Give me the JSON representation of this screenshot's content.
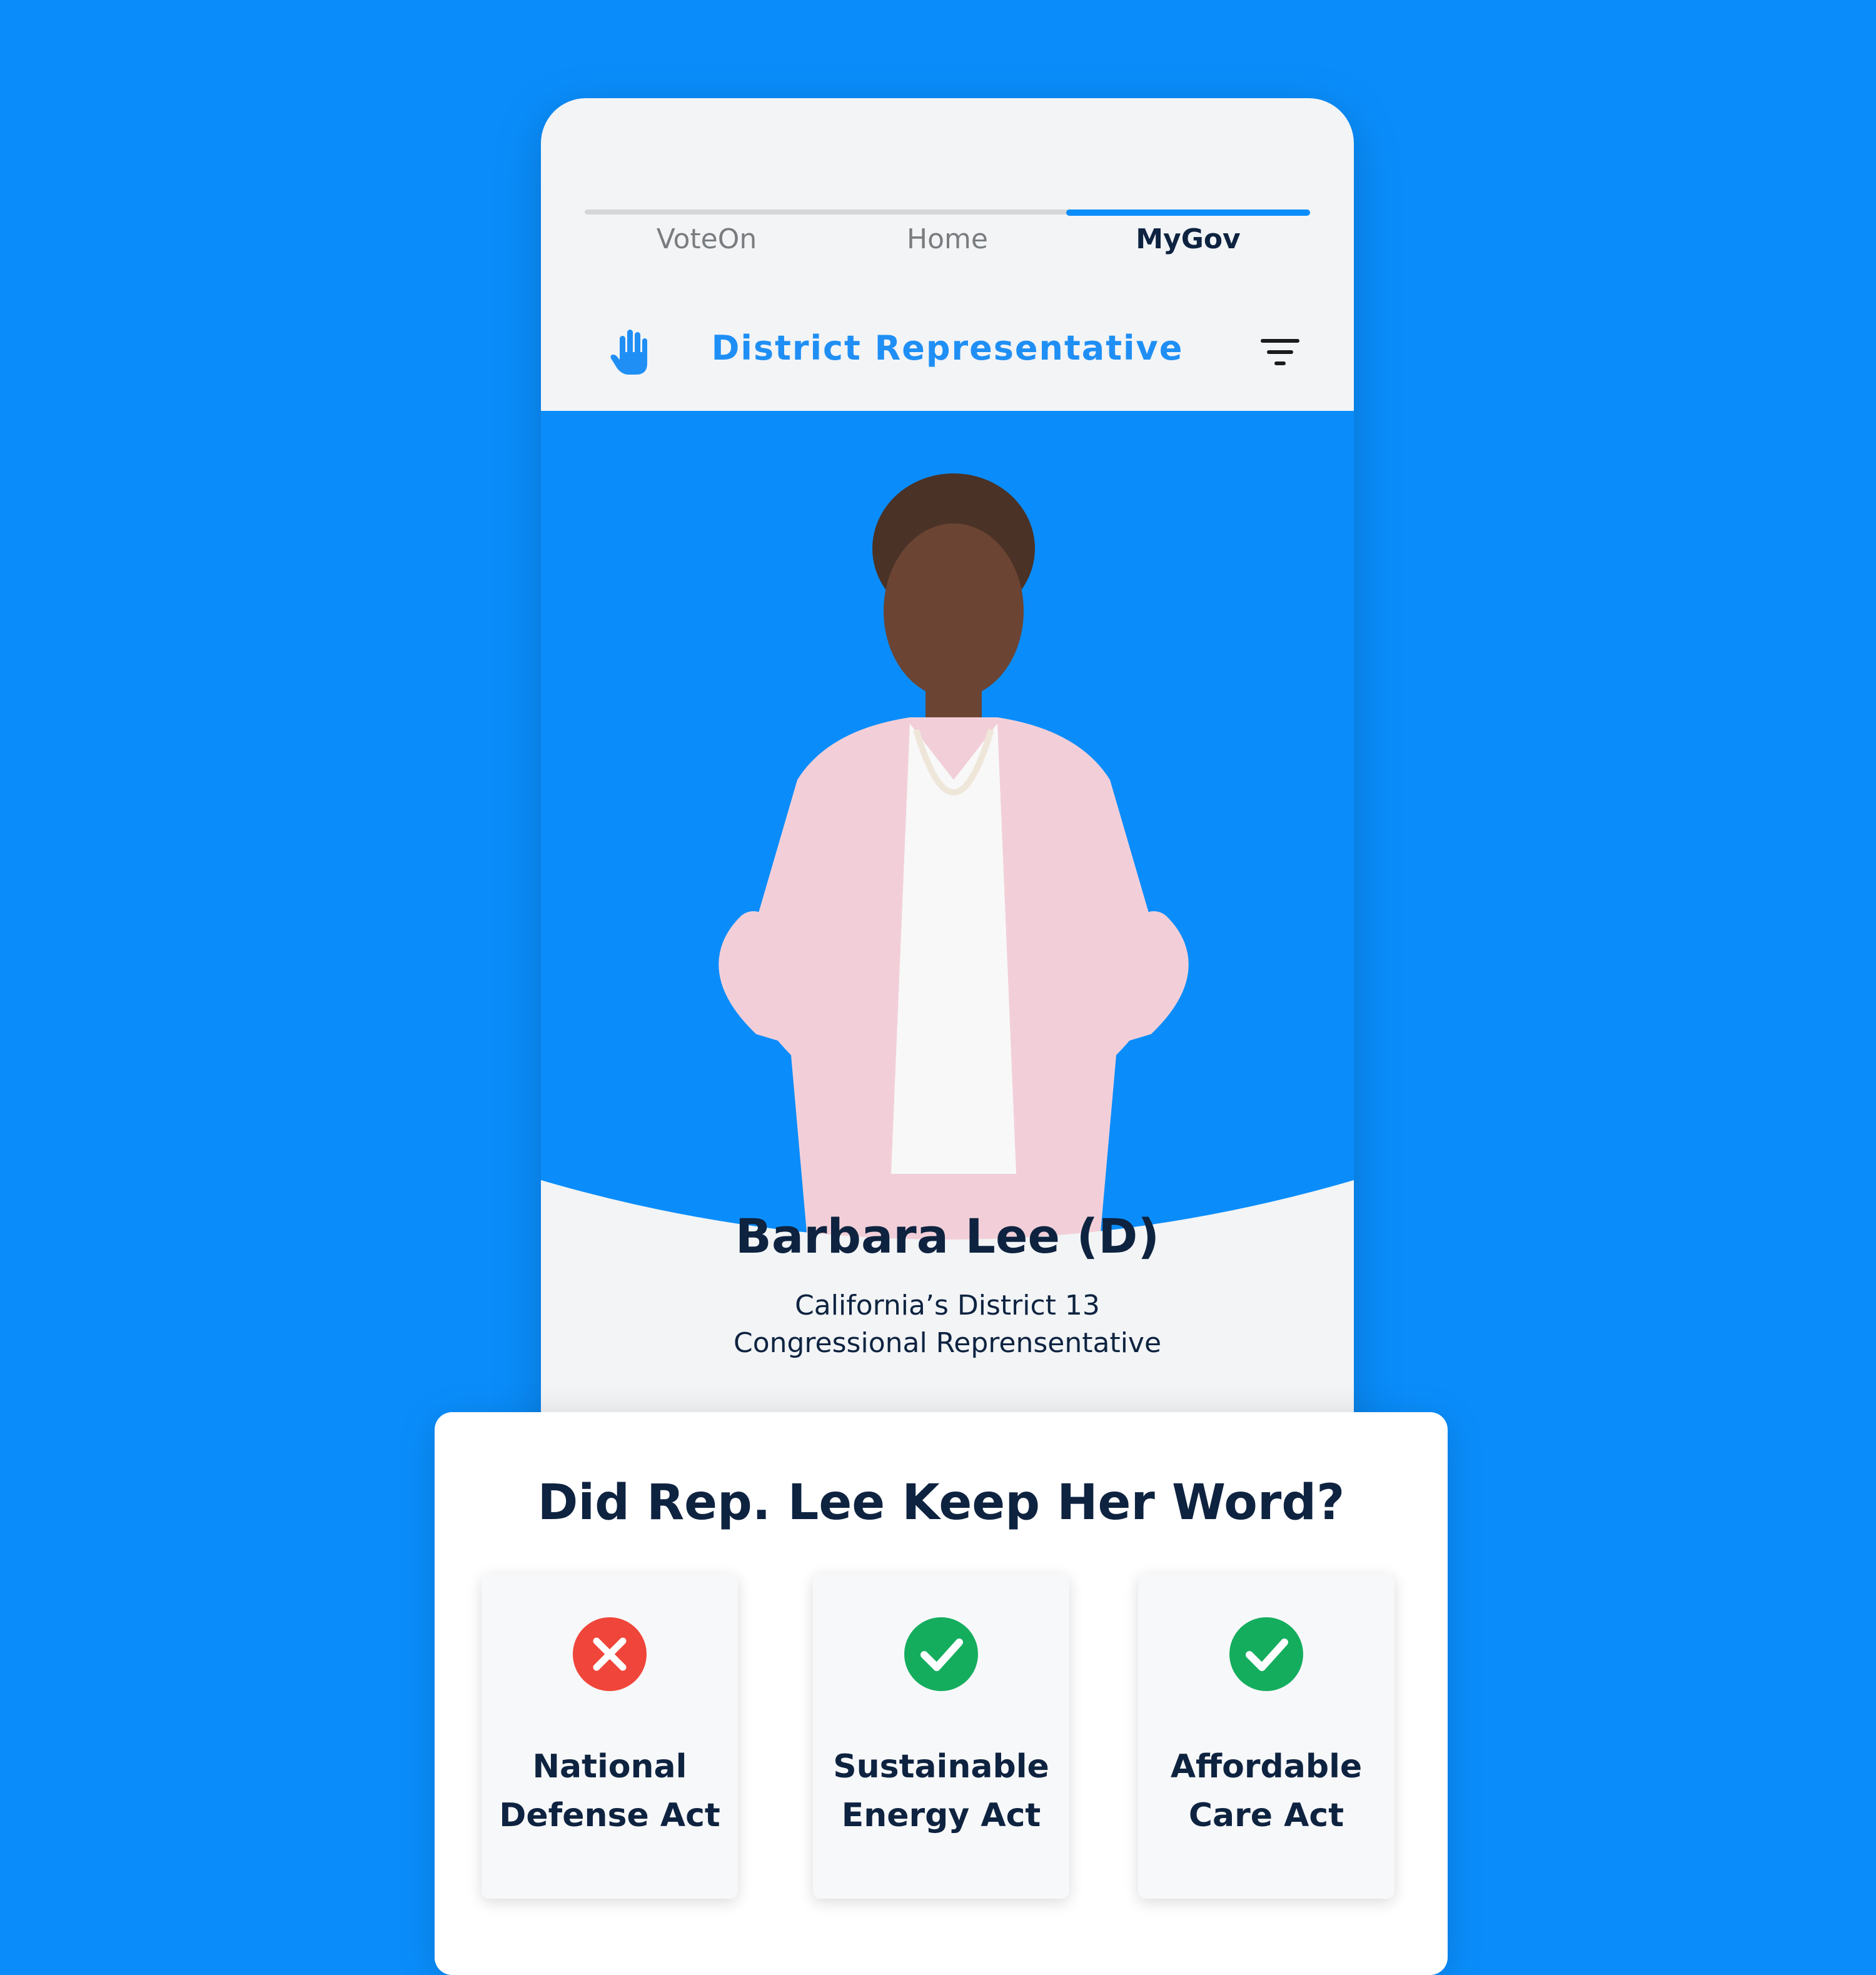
{
  "nav": {
    "tabs": [
      {
        "label": "VoteOn",
        "active": false
      },
      {
        "label": "Home",
        "active": false
      },
      {
        "label": "MyGov",
        "active": true
      }
    ]
  },
  "header": {
    "title": "District Representative",
    "left_icon": "hand-icon",
    "right_icon": "filter-icon"
  },
  "representative": {
    "name": "Barbara Lee (D)",
    "line1": "California’s District 13",
    "line2": "Congressional Reprensentative"
  },
  "promises": {
    "title": "Did Rep. Lee Keep Her Word?",
    "items": [
      {
        "line1": "National",
        "line2": "Defense Act",
        "status": "broken",
        "icon": "x-circle-icon",
        "color": "#f0453a"
      },
      {
        "line1": "Sustainable",
        "line2": "Energy Act",
        "status": "kept",
        "icon": "check-circle-icon",
        "color": "#14ad5e"
      },
      {
        "line1": "Affordable",
        "line2": "Care Act",
        "status": "kept",
        "icon": "check-circle-icon",
        "color": "#14ad5e"
      }
    ]
  },
  "colors": {
    "background": "#0a8dfb",
    "accent": "#1f8ff5",
    "text_dark": "#0e2340",
    "screen_bg": "#f2f4f6"
  }
}
